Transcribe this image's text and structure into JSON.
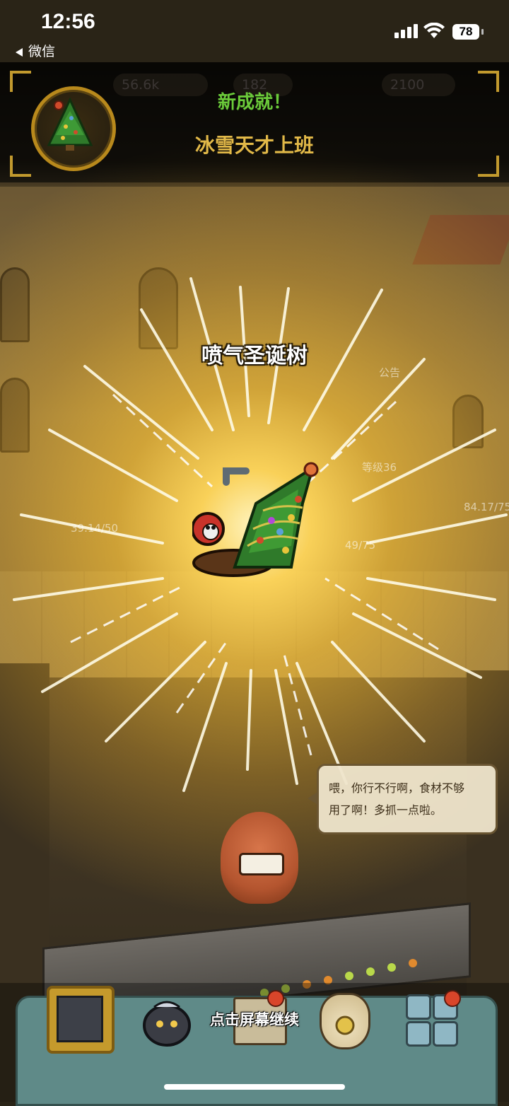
{
  "status_bar": {
    "time": "12:56",
    "back_label": "微信",
    "battery": "78"
  },
  "top_bar": {
    "resource_1": "56.6k",
    "resource_2": "182",
    "resource_3": "2100"
  },
  "achievement": {
    "title": "新成就！",
    "name": "冰雪天才上班",
    "title_color": "#6bcb3a",
    "name_color": "#e2b948"
  },
  "reward_item": {
    "name": "喷气圣诞树"
  },
  "scene": {
    "notice_label": "公告",
    "level_label": "等级36",
    "counter_left": "39.14/50",
    "counter_mid": "49/75",
    "counter_right": "84.17/75",
    "speech_line1": "喂，你行不行啊，食材不够",
    "speech_line2": "用了啊！多抓一点啦。"
  },
  "bottom_bar": {
    "continue_hint": "点击屏幕继续"
  },
  "colors": {
    "glow": "#ffd85a",
    "bottom_bar": "#5f8a88",
    "frame_gold": "#c29a2e"
  }
}
